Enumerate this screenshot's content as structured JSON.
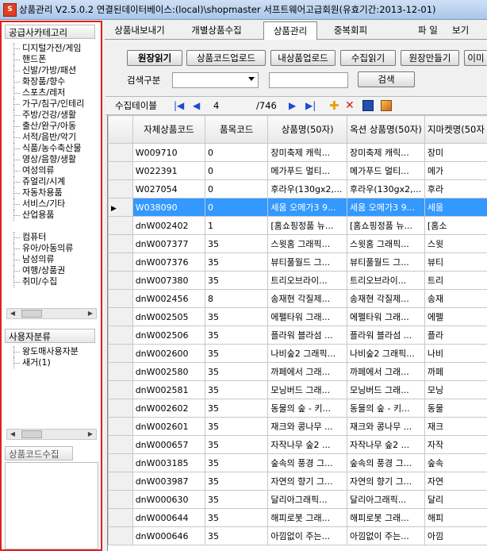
{
  "window": {
    "title": "상품관리 V2.5.0.2 연결된데이터베이스:(local)\\shopmaster 서프트웨어고급회원(유효기간:2013-12-01)"
  },
  "left": {
    "supplier_header": "공급사카테고리",
    "categories": [
      "디지털가전/게임",
      "핸드폰",
      "신발/가방/패션",
      "화장품/향수",
      "스포츠/레저",
      "가구/침구/인테리",
      "주방/건강/생활",
      "출산/완구/아동",
      "서적/음반/악기",
      "식품/농수축산물",
      "영상/음향/생활",
      "여성의류",
      "쥬얼리/시계",
      "자동차용품",
      "서비스/기타",
      "산업용품",
      "",
      "컴퓨터",
      "유아/아동의류",
      "남성의류",
      "여행/상품권",
      "취미/수집"
    ],
    "user_header": "사용자분류",
    "user_items": [
      "왕도매사용자분",
      "새거(1)"
    ],
    "code_collect": "상품코드수집"
  },
  "tabs": [
    "상품내보내기",
    "개별상품수집",
    "상품관리",
    "중복회피"
  ],
  "active_tab": 2,
  "menu": [
    "파 일",
    "보기"
  ],
  "toolbar": {
    "buttons": [
      "원장읽기",
      "상품코드업로드",
      "내상품업로드",
      "수집읽기",
      "원장만들기",
      "이미"
    ],
    "search_label": "검색구분",
    "search_button": "검색"
  },
  "nav": {
    "label": "수집테이블",
    "page": "4",
    "total": "/746"
  },
  "grid": {
    "headers": [
      "자체상품코드",
      "품목코드",
      "상품명(50자)",
      "옥션 상품명(50자)",
      "지마켓명(50자"
    ],
    "rows": [
      [
        "W009710",
        "0",
        "장미축제 캐릭...",
        "장미축제 캐릭...",
        "장미"
      ],
      [
        "W022391",
        "0",
        "메가푸드 멀티...",
        "메가푸드 멀티...",
        "메가"
      ],
      [
        "W027054",
        "0",
        "후라우(130gx2,...",
        "후라우(130gx2,...",
        "후라"
      ],
      [
        "W038090",
        "0",
        "세움 오메가3 9...",
        "세움 오메가3 9...",
        "세움"
      ],
      [
        "dnW002402",
        "1",
        "[홈쇼핑정품 뉴...",
        "[홈쇼핑정품 뉴...",
        "[홈소"
      ],
      [
        "dnW007377",
        "35",
        "스윗홈 그래픽...",
        "스윗홈 그래픽...",
        "스윗"
      ],
      [
        "dnW007376",
        "35",
        "뷰티풀월드 그...",
        "뷰티풀월드 그...",
        "뷰티"
      ],
      [
        "dnW007380",
        "35",
        "트리오브라이...",
        "트리오브라이...",
        "트리"
      ],
      [
        "dnW002456",
        "8",
        "송재현 각질제...",
        "송재현 각질제...",
        "송재"
      ],
      [
        "dnW002505",
        "35",
        "에펠타워 그래...",
        "에펠타워 그래...",
        "에펠"
      ],
      [
        "dnW002506",
        "35",
        "플라워 블라섬 ...",
        "플라워 블라섬 ...",
        "플라"
      ],
      [
        "dnW002600",
        "35",
        "나비숲2 그래픽...",
        "나비숲2 그래픽...",
        "나비"
      ],
      [
        "dnW002580",
        "35",
        "까페에서 그래...",
        "까페에서 그래...",
        "까페"
      ],
      [
        "dnW002581",
        "35",
        "모닝버드 그래...",
        "모닝버드 그래...",
        "모닝"
      ],
      [
        "dnW002602",
        "35",
        "동물의 숲 - 키...",
        "동물의 숲 - 키...",
        "동물"
      ],
      [
        "dnW002601",
        "35",
        "재크와 콩나무 ...",
        "재크와 콩나무 ...",
        "재크"
      ],
      [
        "dnW000657",
        "35",
        "자작나무 숲2 ...",
        "자작나무 숲2 ...",
        "자작"
      ],
      [
        "dnW003185",
        "35",
        "숲속의 풍경 그...",
        "숲속의 풍경 그...",
        "숲속"
      ],
      [
        "dnW003987",
        "35",
        "자연의 향기 그...",
        "자연의 향기 그...",
        "자연"
      ],
      [
        "dnW000630",
        "35",
        "달리아그래픽...",
        "달리아그래픽...",
        "달리"
      ],
      [
        "dnW000644",
        "35",
        "해피로봇 그래...",
        "해피로봇 그래...",
        "해피"
      ],
      [
        "dnW000646",
        "35",
        "아낌없이 주는...",
        "아낌없이 주는...",
        "아낌"
      ]
    ],
    "selected_row": 3
  },
  "colors": {
    "selection": "#3399ff",
    "highlight_border": "#e02020"
  }
}
